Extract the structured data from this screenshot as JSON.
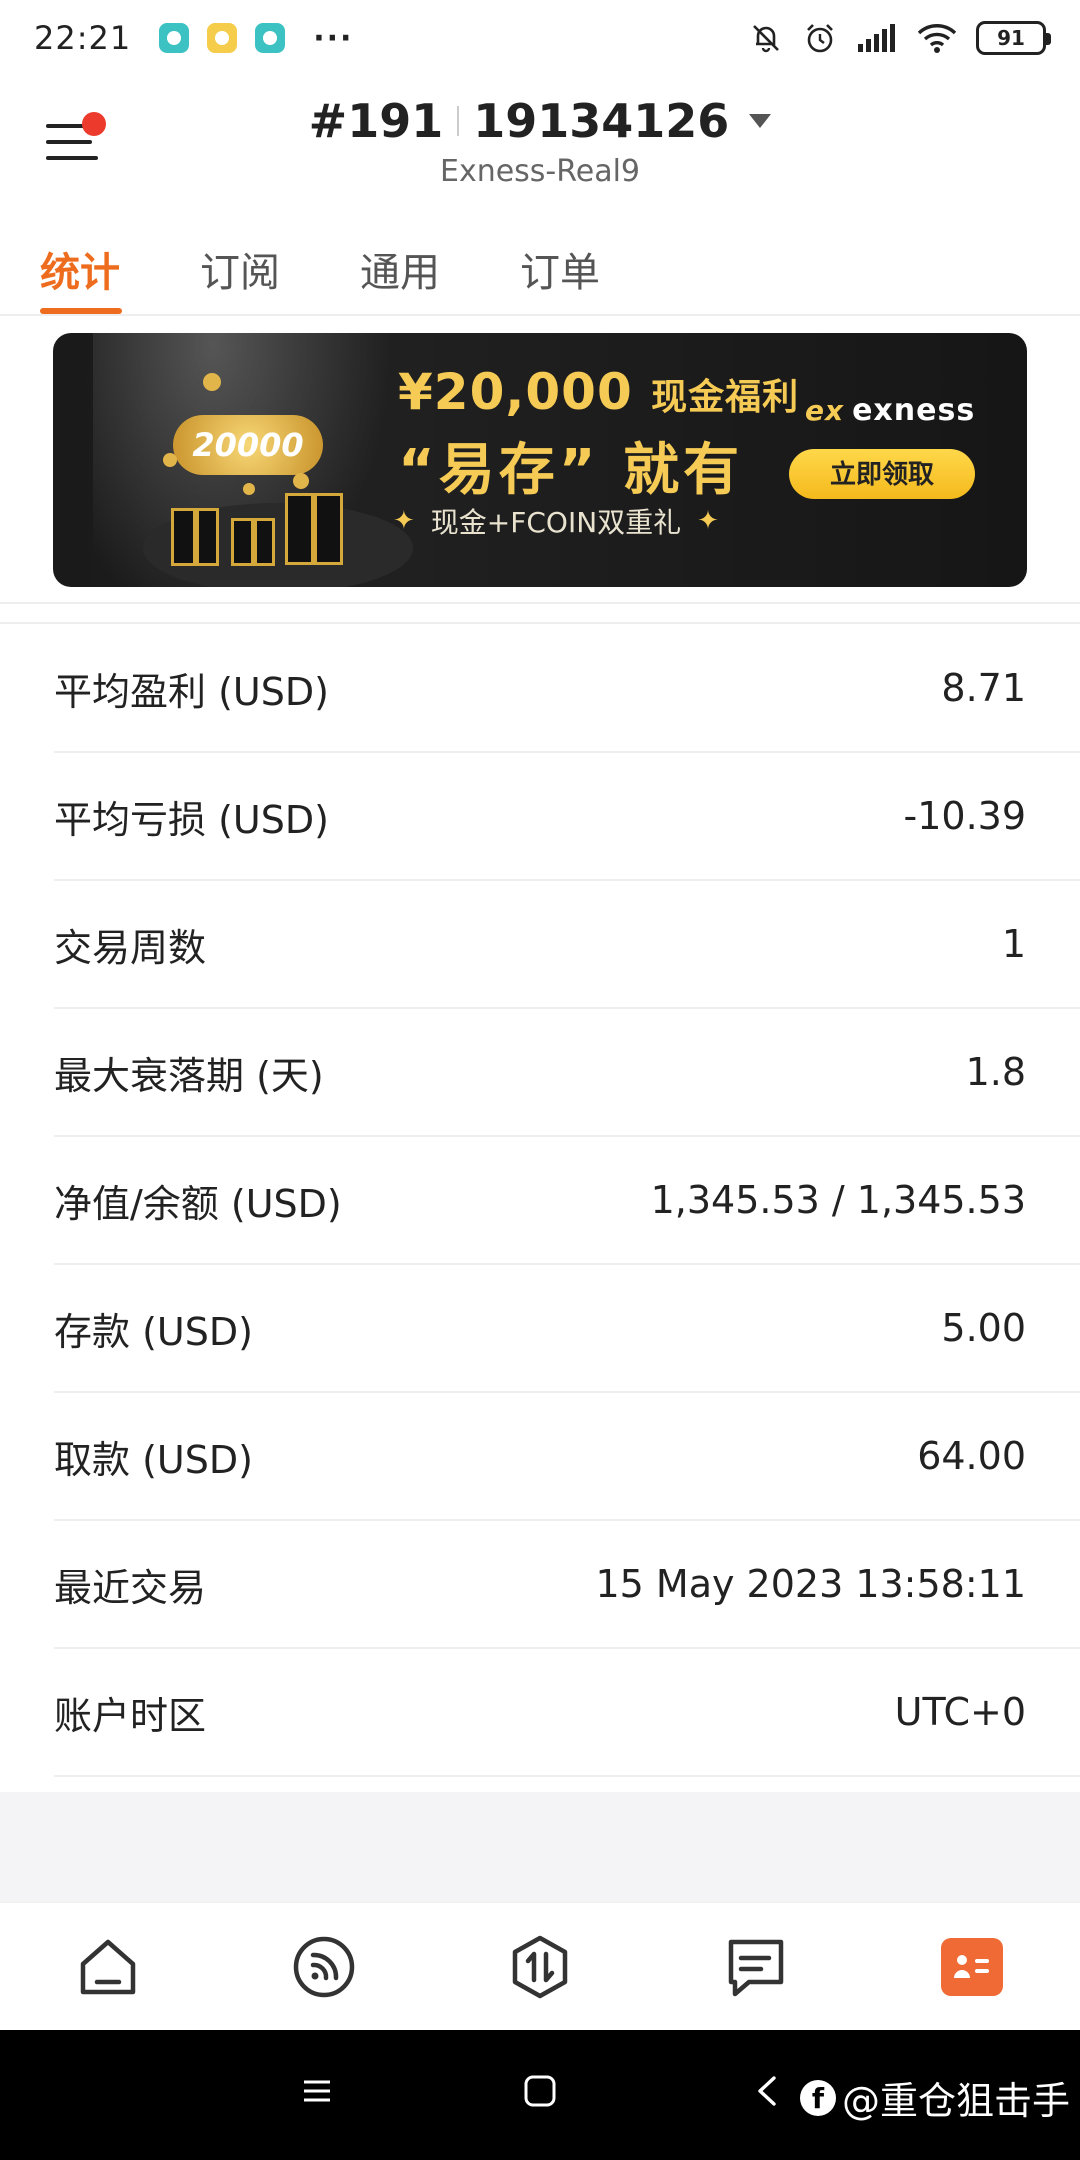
{
  "status_bar": {
    "time": "22:21",
    "more": "···",
    "battery": "91",
    "icons": [
      "app-icon-teal",
      "message-icon",
      "app-icon-teal",
      "mute-icon",
      "alarm-icon",
      "signal-icon",
      "wifi-icon",
      "battery-icon"
    ]
  },
  "header": {
    "account_prefix": "#191",
    "account_number": "19134126",
    "server": "Exness-Real9",
    "menu_icon": "menu-icon",
    "has_notification_dot": true
  },
  "tabs": [
    {
      "label": "统计",
      "active": true
    },
    {
      "label": "订阅",
      "active": false
    },
    {
      "label": "通用",
      "active": false
    },
    {
      "label": "订单",
      "active": false
    }
  ],
  "banner": {
    "amount_label": "¥20,000",
    "amount_suffix": "现金福利",
    "headline": "“易存” 就有",
    "gift_line": "现金+FCOIN双重礼",
    "badge_text": "20000",
    "brand": "exness",
    "brand_mark": "ex",
    "cta": "立即领取",
    "accent_color": "#f6cb55"
  },
  "stats": [
    {
      "label": "平均盈利 (USD)",
      "value": "8.71"
    },
    {
      "label": "平均亏损 (USD)",
      "value": "-10.39"
    },
    {
      "label": "交易周数",
      "value": "1"
    },
    {
      "label": "最大衰落期 (天)",
      "value": "1.8"
    },
    {
      "label": "净值/余额 (USD)",
      "value": "1,345.53 / 1,345.53"
    },
    {
      "label": "存款 (USD)",
      "value": "5.00"
    },
    {
      "label": "取款 (USD)",
      "value": "64.00"
    },
    {
      "label": "最近交易",
      "value": "15 May 2023 13:58:11"
    },
    {
      "label": "账户时区",
      "value": "UTC+0"
    }
  ],
  "bottom_nav": [
    {
      "name": "home",
      "icon": "home-icon",
      "active": false
    },
    {
      "name": "feed",
      "icon": "broadcast-icon",
      "active": false
    },
    {
      "name": "trade",
      "icon": "trade-icon",
      "active": false
    },
    {
      "name": "messages",
      "icon": "chat-icon",
      "active": false
    },
    {
      "name": "account",
      "icon": "profile-card-icon",
      "active": true
    }
  ],
  "accent_color": "#ee6c1d",
  "system_nav": {
    "watermark": "@重仓狙击手"
  }
}
